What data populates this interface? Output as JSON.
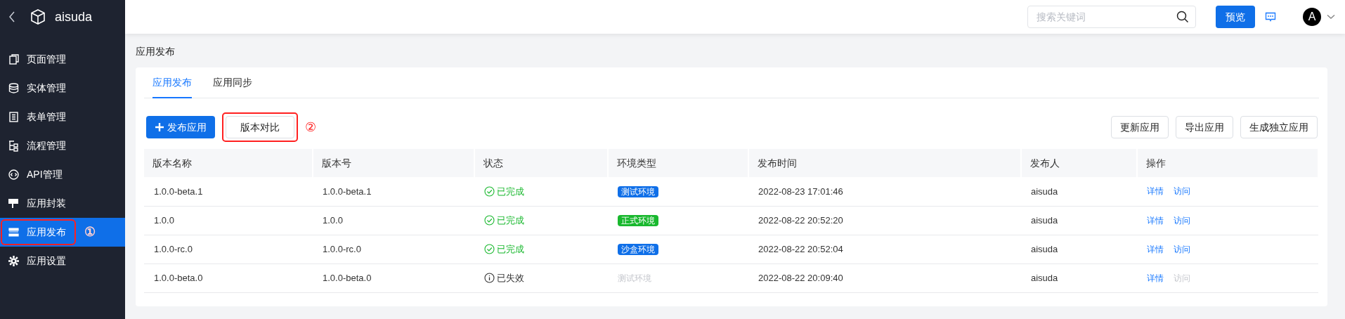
{
  "sidebar": {
    "title": "aisuda",
    "items": [
      {
        "label": "页面管理",
        "selected": false
      },
      {
        "label": "实体管理",
        "selected": false
      },
      {
        "label": "表单管理",
        "selected": false
      },
      {
        "label": "流程管理",
        "selected": false
      },
      {
        "label": "API管理",
        "selected": false
      },
      {
        "label": "应用封装",
        "selected": false
      },
      {
        "label": "应用发布",
        "selected": true,
        "highlighted": true,
        "annotation": "①"
      },
      {
        "label": "应用设置",
        "selected": false
      }
    ]
  },
  "topbar": {
    "search": {
      "placeholder": "搜索关键词"
    },
    "preview_button": "预览",
    "avatar": "A"
  },
  "page_title": "应用发布",
  "tabs": [
    {
      "label": "应用发布",
      "selected": true
    },
    {
      "label": "应用同步",
      "selected": false
    }
  ],
  "toolbar": {
    "left": [
      {
        "label": "发布应用",
        "kind": "primary"
      },
      {
        "label": "版本对比",
        "kind": "default",
        "highlighted": true,
        "annotation": "②"
      }
    ],
    "right": [
      "更新应用",
      "导出应用",
      "生成独立应用"
    ]
  },
  "table": {
    "columns": [
      "版本名称",
      "版本号",
      "状态",
      "环境类型",
      "发布时间",
      "发布人",
      "操作"
    ],
    "rows": [
      {
        "name": "1.0.0-beta.1",
        "version": "1.0.0-beta.1",
        "status": {
          "label": "已完成",
          "kind": "done"
        },
        "env": {
          "label": "测试环境",
          "kind": "blue"
        },
        "time": "2022-08-23 17:01:46",
        "publisher": "aisuda",
        "actions": [
          {
            "label": "详情",
            "disabled": false
          },
          {
            "label": "访问",
            "disabled": false
          }
        ]
      },
      {
        "name": "1.0.0",
        "version": "1.0.0",
        "status": {
          "label": "已完成",
          "kind": "done"
        },
        "env": {
          "label": "正式环境",
          "kind": "green"
        },
        "time": "2022-08-22 20:52:20",
        "publisher": "aisuda",
        "actions": [
          {
            "label": "详情",
            "disabled": false
          },
          {
            "label": "访问",
            "disabled": false
          }
        ]
      },
      {
        "name": "1.0.0-rc.0",
        "version": "1.0.0-rc.0",
        "status": {
          "label": "已完成",
          "kind": "done"
        },
        "env": {
          "label": "沙盒环境",
          "kind": "blue"
        },
        "time": "2022-08-22 20:52:04",
        "publisher": "aisuda",
        "actions": [
          {
            "label": "详情",
            "disabled": false
          },
          {
            "label": "访问",
            "disabled": false
          }
        ]
      },
      {
        "name": "1.0.0-beta.0",
        "version": "1.0.0-beta.0",
        "status": {
          "label": "已失效",
          "kind": "expired"
        },
        "env": {
          "label": "测试环境",
          "kind": "muted"
        },
        "time": "2022-08-22 20:09:40",
        "publisher": "aisuda",
        "actions": [
          {
            "label": "详情",
            "disabled": false
          },
          {
            "label": "访问",
            "disabled": true
          }
        ]
      }
    ]
  }
}
